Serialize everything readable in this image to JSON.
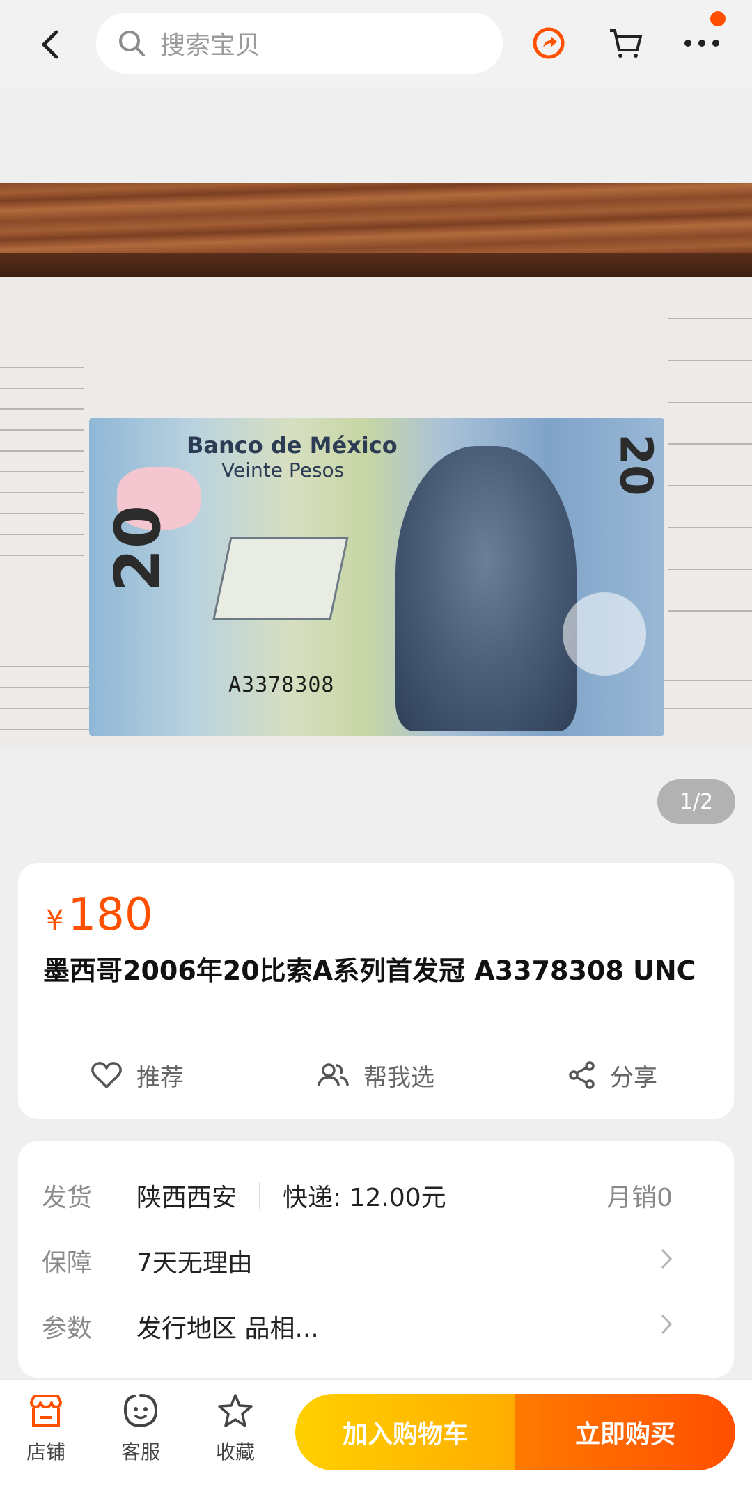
{
  "header": {
    "search_placeholder": "搜索宝贝",
    "accent_color": "#ff5000",
    "icons": [
      "back-icon",
      "search-icon",
      "share-circle-icon",
      "cart-icon",
      "more-icon"
    ],
    "has_notification_dot": true
  },
  "gallery": {
    "counter": "1/2",
    "banknote": {
      "bank": "Banco de México",
      "denomination_text": "Veinte Pesos",
      "value": "20",
      "serial": "A3378308"
    }
  },
  "product": {
    "currency": "¥",
    "price": "180",
    "title": "墨西哥2006年20比索A系列首发冠 A3378308 UNC",
    "actions": [
      {
        "label": "推荐",
        "icon": "heart-icon"
      },
      {
        "label": "帮我选",
        "icon": "people-icon"
      },
      {
        "label": "分享",
        "icon": "share-icon"
      }
    ]
  },
  "info": {
    "shipping": {
      "label": "发货",
      "location": "陕西西安",
      "fee": "快递: 12.00元",
      "sales": "月销0"
    },
    "guarantee": {
      "label": "保障",
      "value": "7天无理由"
    },
    "params": {
      "label": "参数",
      "value": "发行地区 品相..."
    }
  },
  "bottom": {
    "nav": [
      {
        "label": "店铺",
        "icon": "shop-icon"
      },
      {
        "label": "客服",
        "icon": "service-icon"
      },
      {
        "label": "收藏",
        "icon": "star-icon"
      }
    ],
    "add_to_cart": "加入购物车",
    "buy_now": "立即购买"
  }
}
